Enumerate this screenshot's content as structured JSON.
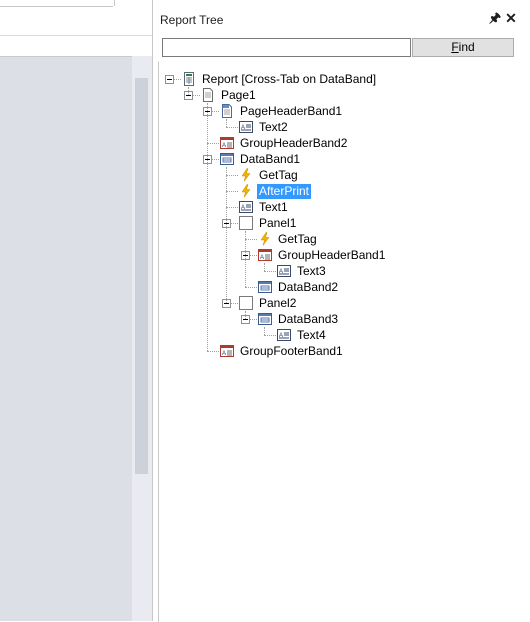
{
  "panel": {
    "title": "Report Tree",
    "pin_icon": "pin-icon",
    "close_icon": "close-icon",
    "search": {
      "value": "",
      "placeholder": ""
    },
    "find_button": {
      "label_prefix": "",
      "label_accel": "F",
      "label_rest": "ind"
    }
  },
  "tree": [
    {
      "label": "Report [Cross-Tab on DataBand]",
      "icon": "report-icon",
      "level": 0,
      "expanded": true
    },
    {
      "label": "Page1",
      "icon": "page-icon",
      "level": 1,
      "expanded": true
    },
    {
      "label": "PageHeaderBand1",
      "icon": "page-header-band-icon",
      "level": 2,
      "expanded": true
    },
    {
      "label": "Text2",
      "icon": "text-icon",
      "level": 3
    },
    {
      "label": "GroupHeaderBand2",
      "icon": "group-header-band-icon",
      "level": 2
    },
    {
      "label": "DataBand1",
      "icon": "data-band-icon",
      "level": 2,
      "expanded": true
    },
    {
      "label": "GetTag",
      "icon": "event-icon",
      "level": 3
    },
    {
      "label": "AfterPrint",
      "icon": "event-icon",
      "level": 3,
      "selected": true
    },
    {
      "label": "Text1",
      "icon": "text-icon",
      "level": 3
    },
    {
      "label": "Panel1",
      "icon": "panel-icon",
      "level": 3,
      "expanded": true
    },
    {
      "label": "GetTag",
      "icon": "event-icon",
      "level": 4
    },
    {
      "label": "GroupHeaderBand1",
      "icon": "group-header-band-icon",
      "level": 4,
      "expanded": true
    },
    {
      "label": "Text3",
      "icon": "text-icon",
      "level": 5
    },
    {
      "label": "DataBand2",
      "icon": "data-band-icon",
      "level": 4
    },
    {
      "label": "Panel2",
      "icon": "panel-icon",
      "level": 3,
      "expanded": true
    },
    {
      "label": "DataBand3",
      "icon": "data-band-icon",
      "level": 4,
      "expanded": true
    },
    {
      "label": "Text4",
      "icon": "text-icon",
      "level": 5
    },
    {
      "label": "GroupFooterBand1",
      "icon": "group-footer-band-icon",
      "level": 2
    }
  ],
  "colors": {
    "selection": "#3399ff",
    "event_bolt": "#f0b400",
    "band_red": "#b03a2e",
    "canvas": "#dcdfe6"
  }
}
